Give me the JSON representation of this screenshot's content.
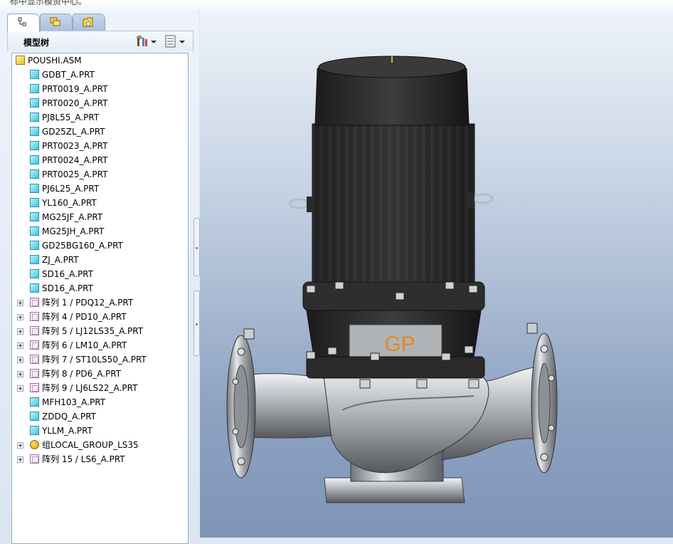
{
  "top_hint": "标中显示模资中心。",
  "tabs": [
    {
      "name": "model-tree",
      "icon": "model-tree-icon",
      "active": true
    },
    {
      "name": "folder-browser",
      "icon": "folder-browser-icon",
      "active": false
    },
    {
      "name": "favorites",
      "icon": "favorites-folder-icon",
      "active": false
    }
  ],
  "model_tree": {
    "title": "模型树",
    "settings_icon": "tree-settings-icon",
    "show_icon": "tree-show-icon",
    "root": "POUSHI.ASM",
    "items": [
      {
        "label": "GDBT_A.PRT",
        "type": "part"
      },
      {
        "label": "PRT0019_A.PRT",
        "type": "part"
      },
      {
        "label": "PRT0020_A.PRT",
        "type": "part"
      },
      {
        "label": "PJ8L55_A.PRT",
        "type": "part"
      },
      {
        "label": "GD25ZL_A.PRT",
        "type": "part"
      },
      {
        "label": "PRT0023_A.PRT",
        "type": "part"
      },
      {
        "label": "PRT0024_A.PRT",
        "type": "part"
      },
      {
        "label": "PRT0025_A.PRT",
        "type": "part"
      },
      {
        "label": "PJ6L25_A.PRT",
        "type": "part"
      },
      {
        "label": "YL160_A.PRT",
        "type": "part"
      },
      {
        "label": "MG25JF_A.PRT",
        "type": "part"
      },
      {
        "label": "MG25JH_A.PRT",
        "type": "part"
      },
      {
        "label": "GD25BG160_A.PRT",
        "type": "part"
      },
      {
        "label": "ZJ_A.PRT",
        "type": "part"
      },
      {
        "label": "SD16_A.PRT",
        "type": "part"
      },
      {
        "label": "SD16_A.PRT",
        "type": "part"
      },
      {
        "label": "阵列 1 / PDQ12_A.PRT",
        "type": "pattern"
      },
      {
        "label": "阵列 4 / PD10_A.PRT",
        "type": "pattern"
      },
      {
        "label": "阵列 5 / LJ12LS35_A.PRT",
        "type": "pattern"
      },
      {
        "label": "阵列 6 / LM10_A.PRT",
        "type": "pattern"
      },
      {
        "label": "阵列 7 / ST10LS50_A.PRT",
        "type": "pattern"
      },
      {
        "label": "阵列 8 / PD6_A.PRT",
        "type": "pattern"
      },
      {
        "label": "阵列 9 / LJ6LS22_A.PRT",
        "type": "pattern"
      },
      {
        "label": "MFH103_A.PRT",
        "type": "part"
      },
      {
        "label": "ZDDQ_A.PRT",
        "type": "part"
      },
      {
        "label": "YLLM_A.PRT",
        "type": "part"
      },
      {
        "label": "组LOCAL_GROUP_LS35",
        "type": "group"
      },
      {
        "label": "阵列 15 / LS6_A.PRT",
        "type": "pattern"
      }
    ]
  },
  "viewport": {
    "logo_text": "GP",
    "logo_color": "#e08a1e",
    "motor_color": "#2b2b2b",
    "casing_color": "#b9bcc0"
  }
}
